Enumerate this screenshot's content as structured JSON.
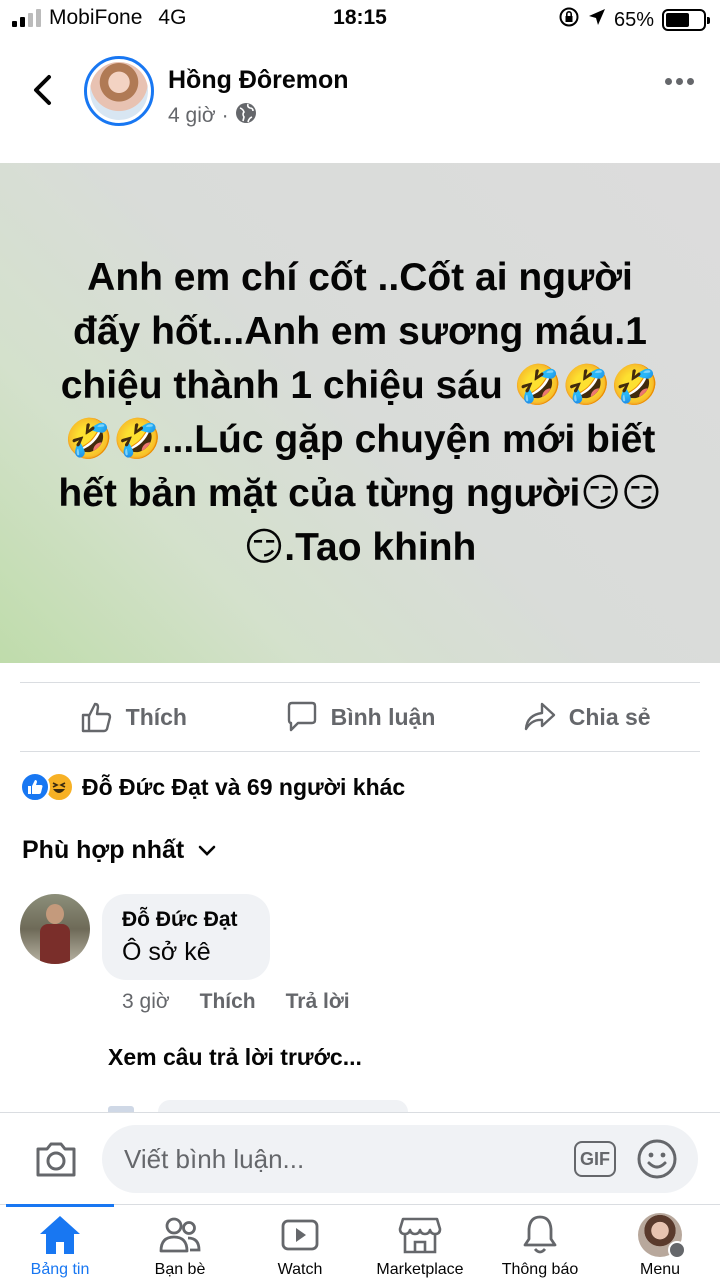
{
  "status_bar": {
    "carrier": "MobiFone",
    "network": "4G",
    "time": "18:15",
    "battery": "65%",
    "battery_level": 0.65
  },
  "post": {
    "author": "Hồng Đôremon",
    "time": "4 giờ",
    "separator": "·",
    "privacy_icon": "globe-icon",
    "text": "Anh em chí cốt ..Cốt ai người đấy hốt...Anh em sương máu.1 chiệu thành 1 chiệu sáu 🤣🤣🤣🤣🤣...Lúc gặp chuyện mới biết hết bản mặt của từng người😏😏😏.Tao khinh",
    "actions": {
      "like": "Thích",
      "comment": "Bình luận",
      "share": "Chia sẻ"
    },
    "reactions_summary": "Đỗ Đức Đạt và 69 người khác"
  },
  "comments_sort": "Phù hợp nhất",
  "comment": {
    "author": "Đỗ Đức Đạt",
    "text": "Ô sở kê",
    "time": "3 giờ",
    "like": "Thích",
    "reply": "Trả lời"
  },
  "view_previous": "Xem câu trả lời trước...",
  "composer": {
    "placeholder": "Viết bình luận...",
    "gif": "GIF"
  },
  "tabs": [
    {
      "label": "Bảng tin",
      "icon": "home-icon",
      "active": true
    },
    {
      "label": "Bạn bè",
      "icon": "friends-icon"
    },
    {
      "label": "Watch",
      "icon": "watch-icon"
    },
    {
      "label": "Marketplace",
      "icon": "marketplace-icon"
    },
    {
      "label": "Thông báo",
      "icon": "bell-icon"
    },
    {
      "label": "Menu",
      "icon": "menu-avatar"
    }
  ],
  "colors": {
    "accent": "#1877f2",
    "secondary_text": "#65676b",
    "bubble": "#f0f2f5"
  }
}
